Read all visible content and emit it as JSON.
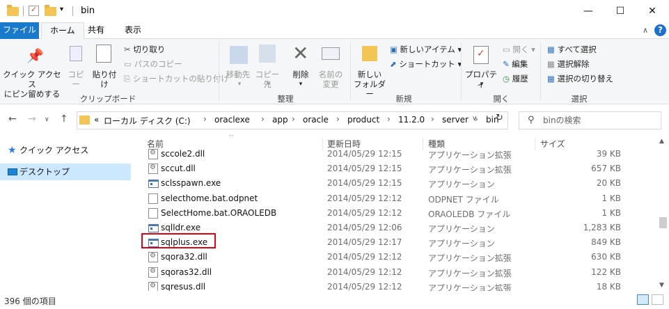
{
  "window": {
    "title": "bin",
    "minimize": "—",
    "maximize": "☐",
    "close": "✕"
  },
  "tabs": [
    "ファイル",
    "ホーム",
    "共有",
    "表示"
  ],
  "ribbon": {
    "quick_access": "クイック アクセス\nにピン留めする",
    "copy": "コピー",
    "paste": "貼り付け",
    "cut": "切り取り",
    "copy_path": "パスのコピー",
    "paste_shortcut": "ショートカットの貼り付け",
    "clipboard_group": "クリップボード",
    "move_to": "移動先",
    "copy_to": "コピー先",
    "delete": "削除",
    "rename": "名前の\n変更",
    "organize_group": "整理",
    "new_folder": "新しい\nフォルダー",
    "new_item": "新しいアイテム",
    "shortcut": "ショートカット",
    "new_group": "新規",
    "properties": "プロパティ",
    "open": "開く",
    "edit": "編集",
    "history": "履歴",
    "open_group": "開く",
    "select_all": "すべて選択",
    "select_none": "選択解除",
    "invert_selection": "選択の切り替え",
    "select_group": "選択"
  },
  "address": {
    "crumbs": [
      "ローカル ディスク (C:)",
      "oraclexe",
      "app",
      "oracle",
      "product",
      "11.2.0",
      "server",
      "bin"
    ],
    "overflow": "«",
    "search_placeholder": "binの検索"
  },
  "navpane": {
    "items": [
      "クイック アクセス",
      "デスクトップ"
    ]
  },
  "columns": {
    "name": "名前",
    "date": "更新日時",
    "type": "種類",
    "size": "サイズ"
  },
  "files": [
    {
      "name": "sccole2.dll",
      "date": "2014/05/29 12:15",
      "type": "アプリケーション拡張",
      "size": "39 KB",
      "icon": "dll"
    },
    {
      "name": "sccut.dll",
      "date": "2014/05/29 12:15",
      "type": "アプリケーション拡張",
      "size": "657 KB",
      "icon": "dll"
    },
    {
      "name": "sclsspawn.exe",
      "date": "2014/05/29 12:15",
      "type": "アプリケーション",
      "size": "20 KB",
      "icon": "exe"
    },
    {
      "name": "selecthome.bat.odpnet",
      "date": "2014/05/29 12:12",
      "type": "ODPNET ファイル",
      "size": "1 KB",
      "icon": "file"
    },
    {
      "name": "SelectHome.bat.ORAOLEDB",
      "date": "2014/05/29 12:12",
      "type": "ORAOLEDB ファイル",
      "size": "1 KB",
      "icon": "file"
    },
    {
      "name": "sqlldr.exe",
      "date": "2014/05/29 12:06",
      "type": "アプリケーション",
      "size": "1,283 KB",
      "icon": "exe"
    },
    {
      "name": "sqlplus.exe",
      "date": "2014/05/29 12:17",
      "type": "アプリケーション",
      "size": "849 KB",
      "icon": "exe"
    },
    {
      "name": "sqora32.dll",
      "date": "2014/05/29 12:12",
      "type": "アプリケーション拡張",
      "size": "630 KB",
      "icon": "dll"
    },
    {
      "name": "sqoras32.dll",
      "date": "2014/05/29 12:12",
      "type": "アプリケーション拡張",
      "size": "122 KB",
      "icon": "dll"
    },
    {
      "name": "sqresus.dll",
      "date": "2014/05/29 12:12",
      "type": "アプリケーション拡張",
      "size": "18 KB",
      "icon": "dll"
    }
  ],
  "highlight_color": "#e3000f",
  "status": {
    "count": "396 個の項目"
  }
}
